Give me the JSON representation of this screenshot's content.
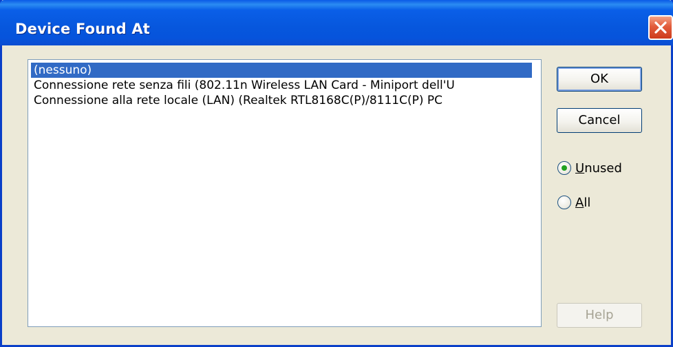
{
  "window": {
    "title": "Device Found At"
  },
  "list": {
    "items": [
      {
        "label": "(nessuno)",
        "selected": true
      },
      {
        "label": "Connessione rete senza fili (802.11n Wireless LAN Card - Miniport dell'U",
        "selected": false
      },
      {
        "label": "Connessione alla rete locale (LAN) (Realtek RTL8168C(P)/8111C(P) PC",
        "selected": false
      }
    ]
  },
  "buttons": {
    "ok": "OK",
    "cancel": "Cancel",
    "help": "Help"
  },
  "radios": {
    "unused": {
      "first": "U",
      "rest": "nused",
      "checked": true
    },
    "all": {
      "first": "A",
      "rest": "ll",
      "checked": false
    }
  },
  "colors": {
    "titlebar": "#0757dd",
    "selection": "#316ac5",
    "radio_dot": "#21a121"
  },
  "icons": {
    "close": "close-icon"
  }
}
